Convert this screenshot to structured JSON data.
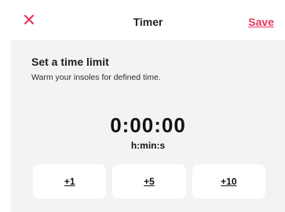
{
  "header": {
    "title": "Timer",
    "close_icon": "close-icon",
    "save_label": "Save",
    "accent_color": "#e8345d"
  },
  "main": {
    "section_title": "Set a time limit",
    "section_subtitle": "Warm your insoles for defined time.",
    "timer_value": "0:00:00",
    "timer_unit": "h:min:s",
    "quick_add": [
      {
        "label": "+1"
      },
      {
        "label": "+5"
      },
      {
        "label": "+10"
      }
    ]
  }
}
